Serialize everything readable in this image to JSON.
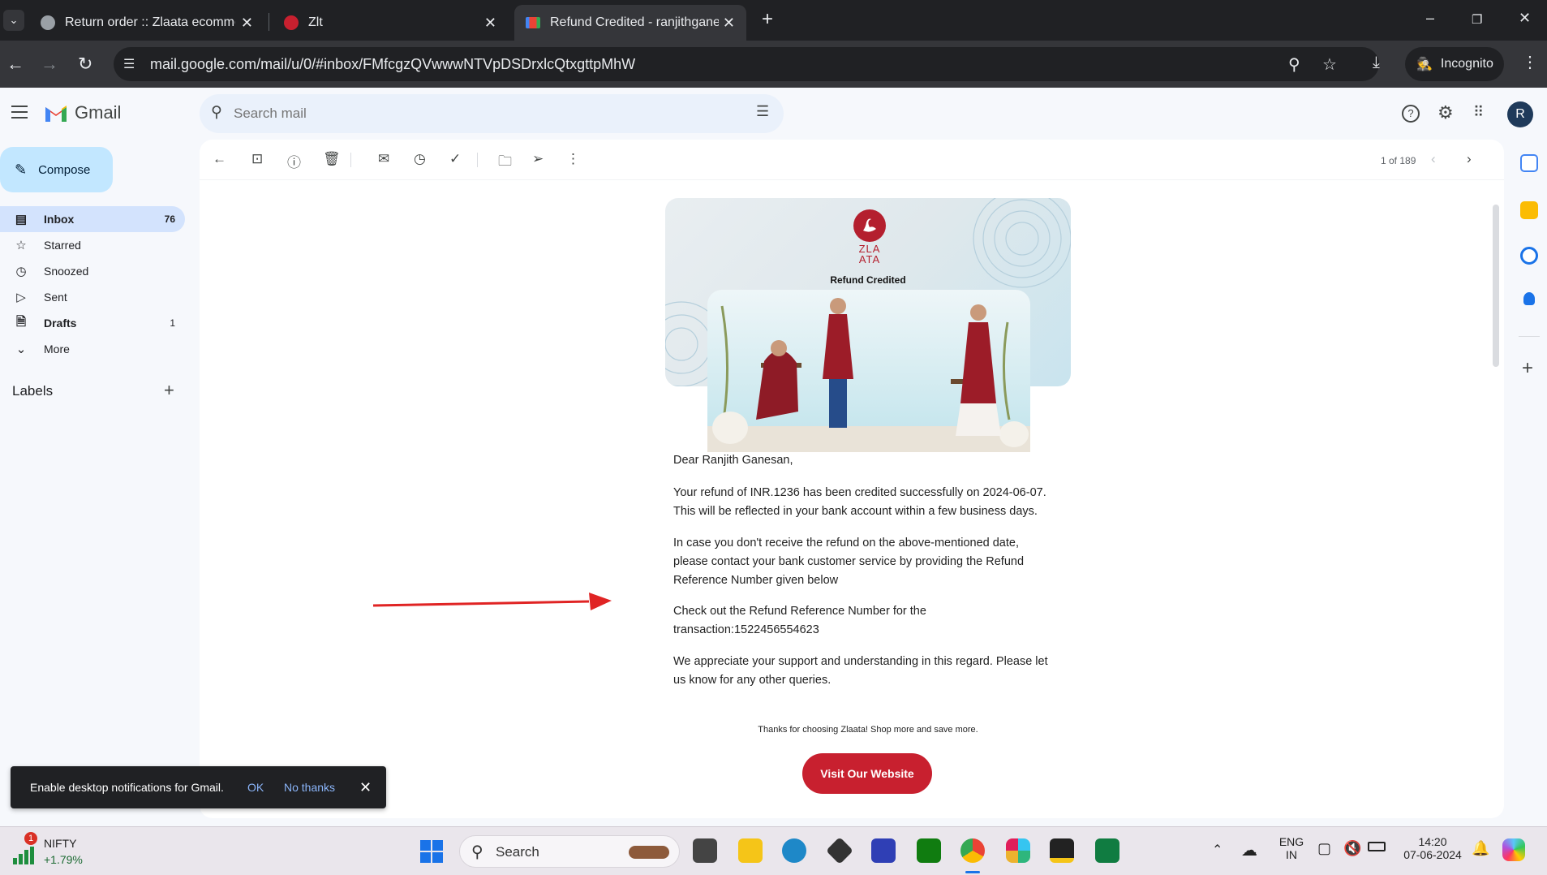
{
  "browser": {
    "tabs": [
      {
        "title": "Return order :: Zlaata ecommerce",
        "active": false
      },
      {
        "title": "Zlt",
        "active": false
      },
      {
        "title": "Refund Credited - ranjithganesan",
        "active": true
      }
    ],
    "url": "mail.google.com/mail/u/0/#inbox/FMfcgzQVwwwNTVpDSDrxlcQtxgttpMhW",
    "incognito_label": "Incognito"
  },
  "gmail": {
    "brand": "Gmail",
    "search_placeholder": "Search mail",
    "avatar_initial": "R",
    "compose_label": "Compose",
    "nav": [
      {
        "label": "Inbox",
        "count": "76",
        "icon": "inbox-icon"
      },
      {
        "label": "Starred",
        "count": "",
        "icon": "star-icon"
      },
      {
        "label": "Snoozed",
        "count": "",
        "icon": "clock-icon"
      },
      {
        "label": "Sent",
        "count": "",
        "icon": "send-icon"
      },
      {
        "label": "Drafts",
        "count": "1",
        "icon": "draft-icon"
      },
      {
        "label": "More",
        "count": "",
        "icon": "chevron-down-icon"
      }
    ],
    "labels_heading": "Labels",
    "pager": "1 of 189"
  },
  "email": {
    "brand_name_line1": "ZLA",
    "brand_name_line2": "ATA",
    "hero_title": "Refund Credited",
    "greeting": "Dear Ranjith Ganesan,",
    "para1_line1": "Your refund of INR.1236 has been credited successfully on 2024-06-07.",
    "para1_line2": "This will be reflected in your bank account within a few business days.",
    "para2_line1": "In case you don't receive the refund on the above-mentioned date,",
    "para2_line2": "please contact your bank customer service by providing the Refund",
    "para2_line3": "Reference Number given below",
    "para3_line1": "Check out the Refund Reference Number for the",
    "para3_line2": "transaction:1522456554623",
    "para4_line1": "We appreciate your support and understanding in this regard. Please let",
    "para4_line2": "us know for any other queries.",
    "thanks": "Thanks for choosing Zlaata! Shop more and save more.",
    "cta": "Visit Our Website"
  },
  "notification": {
    "text": "Enable desktop notifications for Gmail.",
    "ok": "OK",
    "no_thanks": "No thanks"
  },
  "taskbar": {
    "stock_name": "NIFTY",
    "stock_change": "+1.79%",
    "stock_badge": "1",
    "search_label": "Search",
    "lang_line1": "ENG",
    "lang_line2": "IN",
    "time": "14:20",
    "date": "07-06-2024"
  },
  "colors": {
    "brand_red": "#c8202f",
    "annotation_arrow": "#e02424",
    "gmail_selected": "#d3e3fd",
    "compose_bg": "#c2e7ff"
  }
}
